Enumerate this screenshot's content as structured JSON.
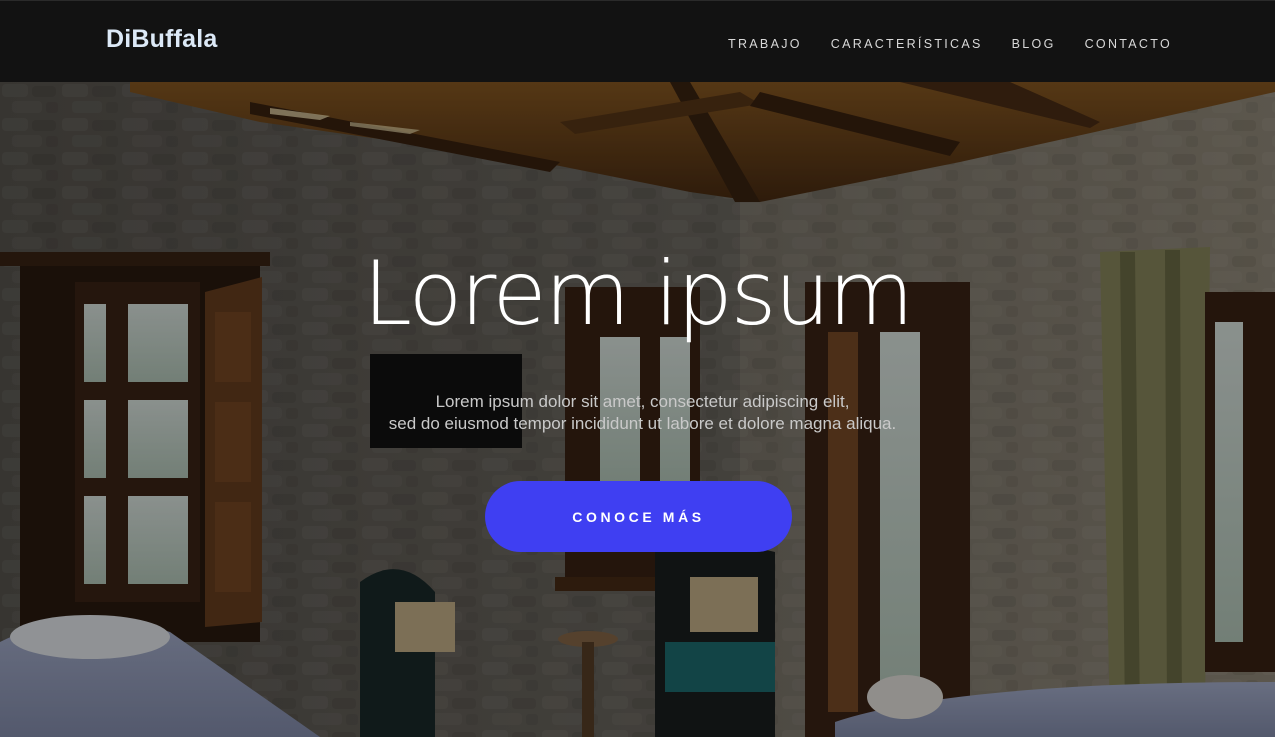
{
  "header": {
    "brand": "DiBuffala",
    "nav": [
      {
        "label": "TRABAJO"
      },
      {
        "label": "CARACTERÍSTICAS"
      },
      {
        "label": "BLOG"
      },
      {
        "label": "CONTACTO"
      }
    ]
  },
  "hero": {
    "title": "Lorem ipsum",
    "subtitle_line1": "Lorem ipsum dolor sit amet, consectetur adipiscing elit,",
    "subtitle_line2": "sed do eiusmod tempor incididunt ut labore et dolore magna aliqua.",
    "cta_label": "CONOCE MÁS",
    "background_image": "hotel-room-photo"
  },
  "colors": {
    "navbar_bg": "#121212",
    "brand": "#dce9f7",
    "cta": "#3f3ff2"
  }
}
